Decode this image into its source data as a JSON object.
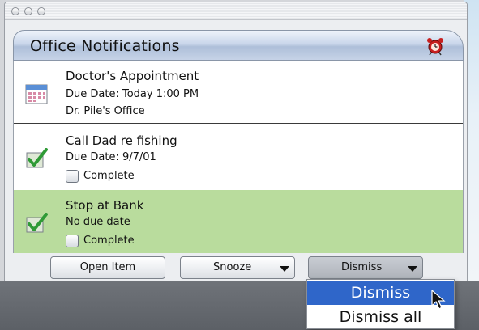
{
  "window": {
    "title": "Office Notifications"
  },
  "notifications": [
    {
      "icon": "calendar-icon",
      "title": "Doctor's Appointment",
      "line1": "Due Date: Today 1:00 PM",
      "line2": "Dr. Pile's Office"
    },
    {
      "icon": "checkmark-icon",
      "title": "Call Dad re fishing",
      "line1": "Due Date: 9/7/01",
      "checkbox_label": "Complete"
    },
    {
      "icon": "checkmark-icon",
      "title": "Stop at Bank",
      "line1": "No due date",
      "checkbox_label": "Complete",
      "selected": true
    }
  ],
  "buttons": {
    "open_item": "Open Item",
    "snooze": "Snooze",
    "dismiss": "Dismiss"
  },
  "dismiss_menu": {
    "items": [
      "Dismiss",
      "Dismiss all"
    ],
    "selected_index": 0
  },
  "colors": {
    "selected_row": "#b9dc9d",
    "menu_highlight": "#2f66c9",
    "check_green": "#3aa33a"
  }
}
